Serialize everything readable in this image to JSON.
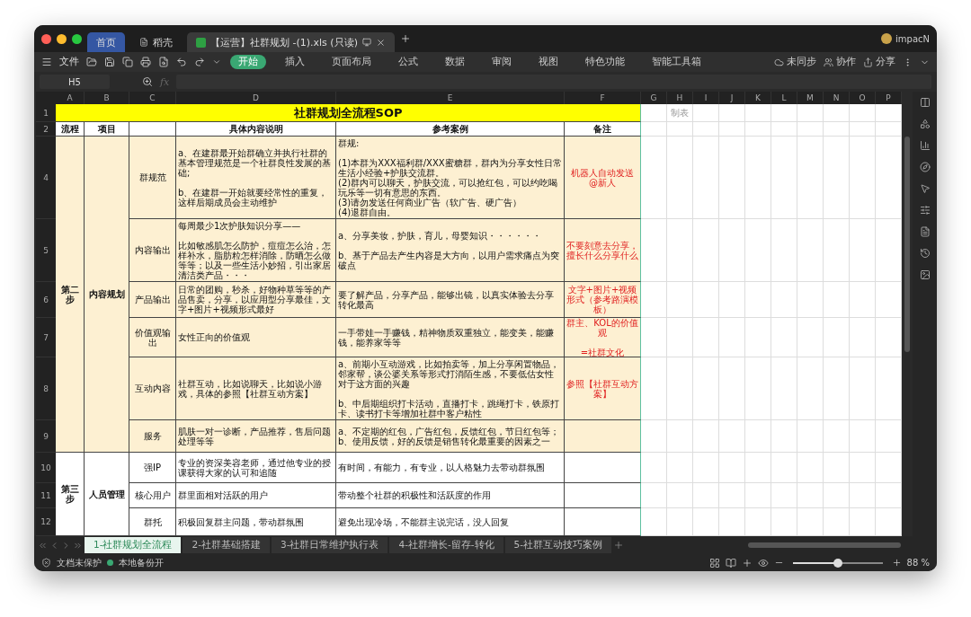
{
  "tabs": [
    {
      "kind": "home",
      "label": "首页",
      "selected": false
    },
    {
      "kind": "doc",
      "label": "稻壳",
      "selected": false
    },
    {
      "kind": "file",
      "label": "【运营】社群规划 -(1).xls (只读)",
      "selected": true
    }
  ],
  "user": "impacN",
  "file_menu": "文件",
  "ribbon_tabs": [
    {
      "label": "开始",
      "selected": true
    },
    {
      "label": "插入",
      "selected": false
    },
    {
      "label": "页面布局",
      "selected": false
    },
    {
      "label": "公式",
      "selected": false
    },
    {
      "label": "数据",
      "selected": false
    },
    {
      "label": "审阅",
      "selected": false
    },
    {
      "label": "视图",
      "selected": false
    },
    {
      "label": "特色功能",
      "selected": false
    },
    {
      "label": "智能工具箱",
      "selected": false
    }
  ],
  "actions": [
    {
      "kind": "sync",
      "label": "未同步"
    },
    {
      "kind": "collab",
      "label": "协作"
    },
    {
      "kind": "share",
      "label": "分享"
    }
  ],
  "name_box": "H5",
  "formula_label": "fx",
  "columns": [
    "A",
    "B",
    "C",
    "D",
    "E",
    "F",
    "G",
    "H",
    "I",
    "J",
    "K",
    "L",
    "M",
    "N",
    "O",
    "P"
  ],
  "sheet": {
    "title_row": "1",
    "title": "社群规划全流程SOP",
    "note": "制表",
    "header_row": "2",
    "header": {
      "flow": "流程",
      "item": "项目",
      "detail": "具体内容说明",
      "example": "参考案例",
      "remark": "备注"
    },
    "groups": [
      {
        "step": "第二步",
        "project": "内容规划",
        "shaded": true,
        "rows": [
          {
            "number": "4",
            "item": "群规范",
            "detail": "a、在建群最开始群确立并执行社群的基本管理规范是一个社群良性发展的基础;\n\nb、在建群一开始就要经常性的重复，这样后期成员会主动维护",
            "example": "群规:\n\n(1)本群为XXX福利群/XXX蜜糖群，群内为分享女性日常生活小经验+护肤交流群。\n(2)群内可以聊天，护肤交流，可以抢红包，可以约吃喝玩乐等一切有意思的东西。\n(3)请勿发送任何商业广告（软广告、硬广告）\n(4)退群自由。",
            "remark": "机器人自动发送\n@新人"
          },
          {
            "number": "5",
            "item": "内容输出",
            "detail": "每周最少1次护肤知识分享——\n\n比如敏感肌怎么防护，痘痘怎么治，怎样补水，脂肪粒怎样消除，防晒怎么做等等；以及一些生活小妙招，引出家居清洁类产品・・・",
            "example": "a、分享美妆，护肤，育儿，母婴知识・・・・・・\n\nb、基于产品去产生内容是大方向，以用户需求痛点为突破点",
            "remark": "不要刻意去分享，擅长什么分享什么"
          },
          {
            "number": "6",
            "item": "产品输出",
            "detail": "日常的团购，秒杀，好物种草等等的产品售卖，分享，以应用型分享最佳，文字+图片+视频形式最好",
            "example": "要了解产品，分享产品，能够出镜，以真实体验去分享转化最高",
            "remark": "文字+图片+视频形式（参考路演模板）"
          },
          {
            "number": "7",
            "item": "价值观输出",
            "detail": "女性正向的价值观",
            "example": "一手带娃一手赚钱，精神物质双重独立，能变美，能赚钱，能养家等等",
            "remark": "群主、KOL的价值观\n\n=社群文化"
          },
          {
            "number": "8",
            "item": "互动内容",
            "detail": "社群互动，比如说聊天，比如说小游戏，具体的参照【社群互动方案】",
            "example": "a、前期小互动游戏，比如拍卖等，加上分享闲置物品，邻家帮，谈公婆关系等形式打消陌生感，不要低估女性对于这方面的兴趣\n\nb、中后期组织打卡活动，直播打卡，跳绳打卡，铁原打卡、读书打卡等增加社群中客户粘性",
            "remark": "参照【社群互动方案】"
          },
          {
            "number": "9",
            "item": "服务",
            "detail": "肌肤一对一诊断，产品推荐，售后问题处理等等",
            "example": "a、不定期的红包，广告红包，反馈红包，节日红包等；\nb、使用反馈，好的反馈是销售转化最重要的因素之一"
          }
        ]
      },
      {
        "step": "第三步",
        "project": "人员管理",
        "shaded": false,
        "rows": [
          {
            "number": "10",
            "item": "强IP",
            "detail": "专业的资深美容老师，通过他专业的授课获得大家的认可和追随",
            "example": "有时间，有能力，有专业，以人格魅力去带动群氛围"
          },
          {
            "number": "11",
            "item": "核心用户",
            "detail": "群里面相对活跃的用户",
            "example": "带动整个社群的积极性和活跃度的作用"
          },
          {
            "number": "12",
            "item": "群托",
            "detail": "积极回复群主问题，带动群氛围",
            "example": "避免出现冷场，不能群主说完话，没人回复"
          }
        ]
      }
    ]
  },
  "sheet_tabs": [
    {
      "label": "1-社群规划全流程",
      "selected": true
    },
    {
      "label": "2-社群基础搭建",
      "selected": false
    },
    {
      "label": "3-社群日常维护执行表",
      "selected": false
    },
    {
      "label": "4-社群增长-留存-转化",
      "selected": false
    },
    {
      "label": "5-社群互动技巧案例",
      "selected": false
    }
  ],
  "status": {
    "protection": "文档未保护",
    "backup": "本地备份开",
    "zoom_slider": {
      "level": 0.5
    },
    "zoom": "88 %"
  }
}
